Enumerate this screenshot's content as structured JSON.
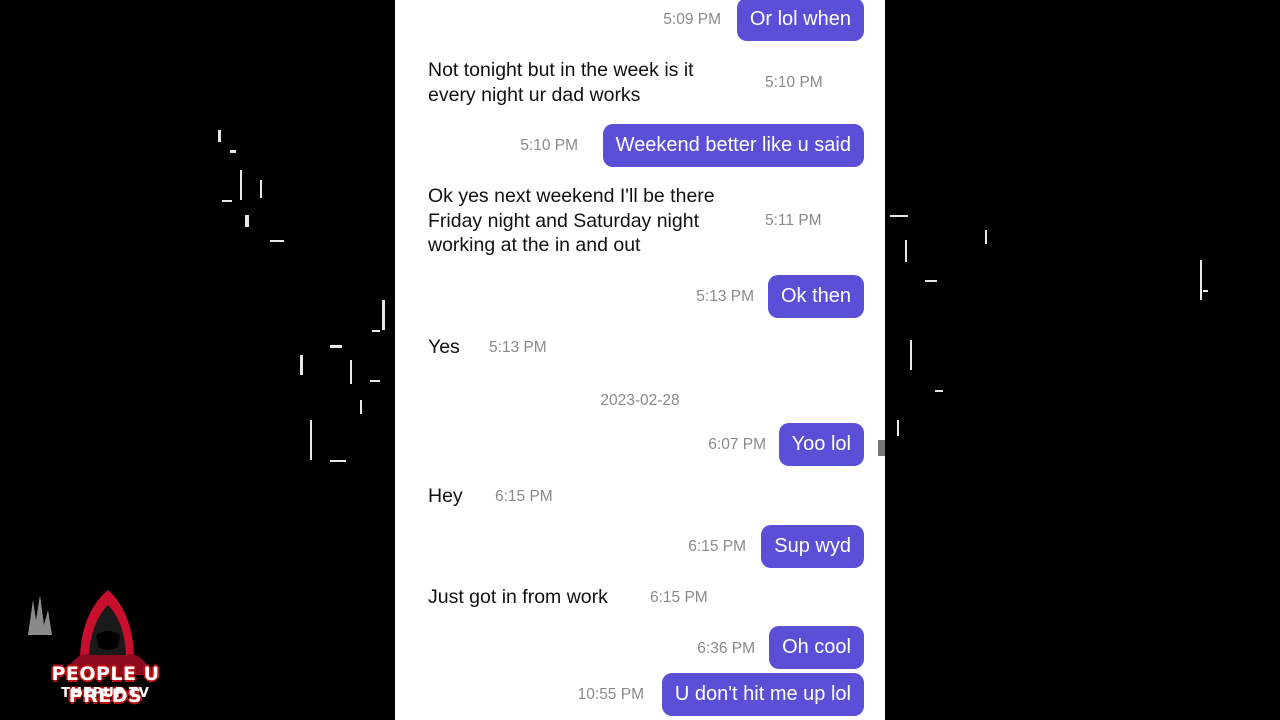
{
  "conversation": {
    "messages": [
      {
        "id": "m1",
        "dir": "out",
        "text": "Or lol when",
        "time": "5:09 PM"
      },
      {
        "id": "m2",
        "dir": "in",
        "text": "Not tonight but in the week is it\nevery night ur dad works",
        "time": "5:10 PM"
      },
      {
        "id": "m3",
        "dir": "out",
        "text": "Weekend better like u said",
        "time": "5:10 PM"
      },
      {
        "id": "m4",
        "dir": "in",
        "text": "Ok yes next weekend I'll be there\nFriday night and Saturday night\nworking at the in and out",
        "time": "5:11 PM"
      },
      {
        "id": "m5",
        "dir": "out",
        "text": "Ok then",
        "time": "5:13 PM"
      },
      {
        "id": "m6",
        "dir": "in",
        "text": "Yes",
        "time": "5:13 PM"
      },
      {
        "id": "m7",
        "dir": "out",
        "text": "Yoo lol",
        "time": "6:07 PM"
      },
      {
        "id": "m8",
        "dir": "in",
        "text": "Hey",
        "time": "6:15 PM"
      },
      {
        "id": "m9",
        "dir": "out",
        "text": "Sup wyd",
        "time": "6:15 PM"
      },
      {
        "id": "m10",
        "dir": "in",
        "text": "Just got in from work",
        "time": "6:15 PM"
      },
      {
        "id": "m11",
        "dir": "out",
        "text": "Oh cool",
        "time": "6:36 PM"
      },
      {
        "id": "m12",
        "dir": "out",
        "text": "U don't hit me up lol",
        "time": "10:55 PM"
      }
    ],
    "date_separator": "2023-02-28"
  },
  "watermark": {
    "title": "PEOPLE U PREDS",
    "subtitle": "THEPUP.TV"
  },
  "colors": {
    "outgoing_bubble": "#5a4fd6",
    "timestamp": "#8a8a8a",
    "background": "#000000"
  },
  "icons": [
    "hooded-figure-icon"
  ]
}
